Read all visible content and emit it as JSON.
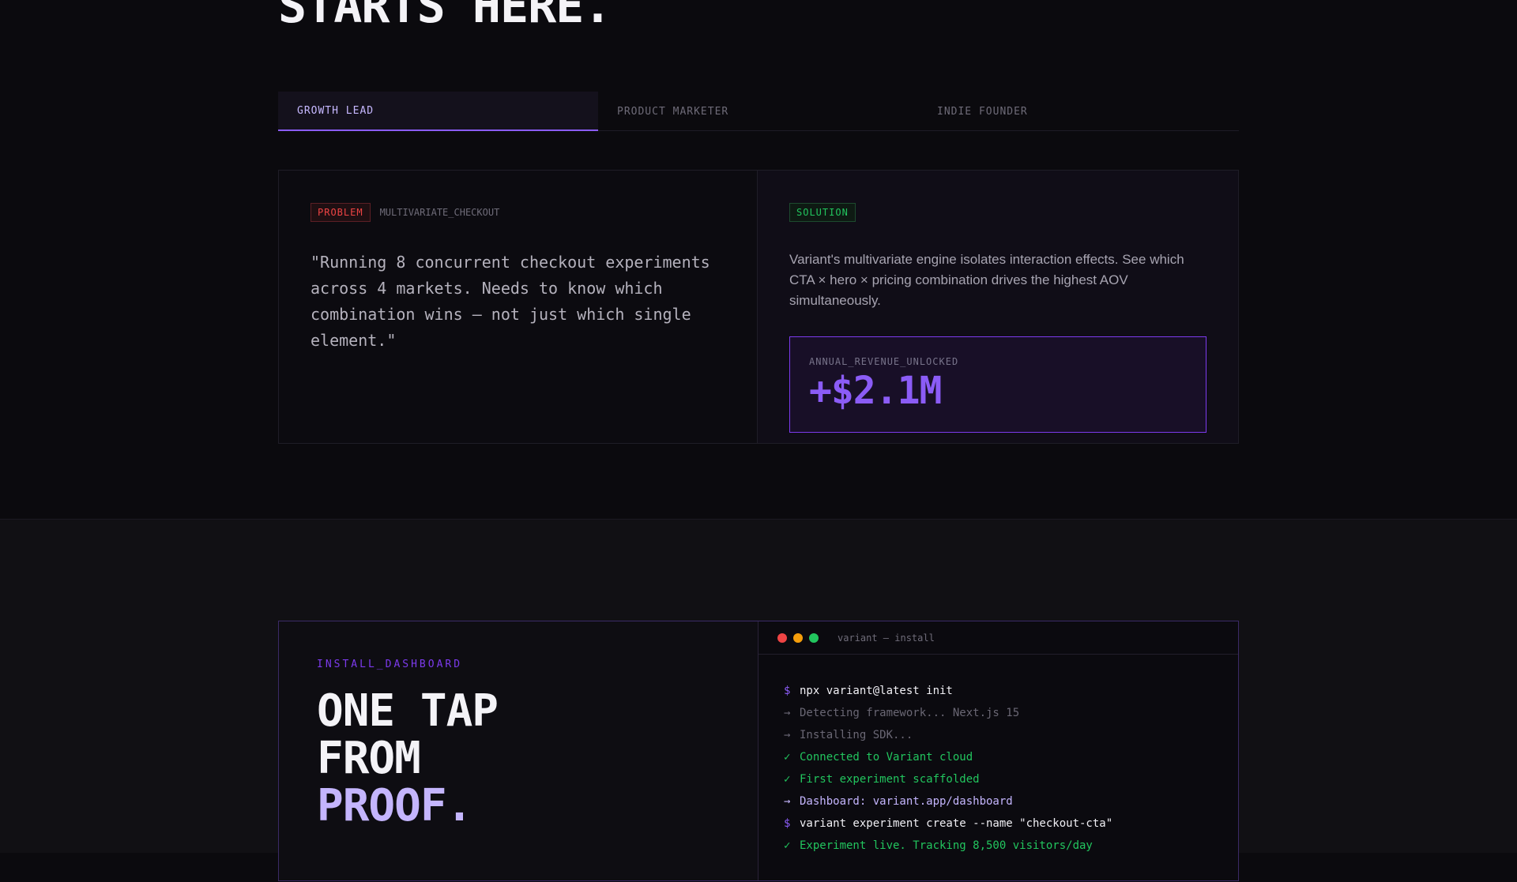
{
  "hero": {
    "title": "STARTS HERE."
  },
  "tabs": [
    {
      "label": "GROWTH LEAD",
      "active": true
    },
    {
      "label": "PRODUCT MARKETER",
      "active": false
    },
    {
      "label": "INDIE FOUNDER",
      "active": false
    }
  ],
  "case": {
    "problem_badge": "PROBLEM",
    "problem_id": "MULTIVARIATE_CHECKOUT",
    "quote": "\"Running 8 concurrent checkout experiments across 4 markets. Needs to know which combination wins — not just which single element.\"",
    "solution_badge": "SOLUTION",
    "solution_text": "Variant's multivariate engine isolates interaction effects. See which CTA × hero × pricing combination drives the highest AOV simultaneously.",
    "metric_label": "ANNUAL_REVENUE_UNLOCKED",
    "metric_value": "+$2.1M"
  },
  "install": {
    "kicker": "INSTALL_DASHBOARD",
    "heading_line1": "ONE TAP",
    "heading_line2": "FROM",
    "heading_line3": "PROOF.",
    "terminal_title": "variant — install",
    "lines": [
      {
        "prefix": "$",
        "text": "npx variant@latest init",
        "kind": "cmd"
      },
      {
        "prefix": "→",
        "text": "Detecting framework... Next.js 15",
        "kind": "muted"
      },
      {
        "prefix": "→",
        "text": "Installing SDK...",
        "kind": "muted"
      },
      {
        "prefix": "✓",
        "text": "Connected to Variant cloud",
        "kind": "ok"
      },
      {
        "prefix": "✓",
        "text": "First experiment scaffolded",
        "kind": "ok"
      },
      {
        "prefix": "→",
        "text": "Dashboard: variant.app/dashboard",
        "kind": "link"
      },
      {
        "prefix": "$",
        "text": "variant experiment create --name \"checkout-cta\"",
        "kind": "cmd"
      },
      {
        "prefix": "✓",
        "text": "Experiment live. Tracking 8,500 visitors/day",
        "kind": "ok"
      }
    ]
  },
  "colors": {
    "accent": "#8b5cf6",
    "success": "#22c55e",
    "danger": "#ef4444",
    "background": "#0b0a0e"
  }
}
